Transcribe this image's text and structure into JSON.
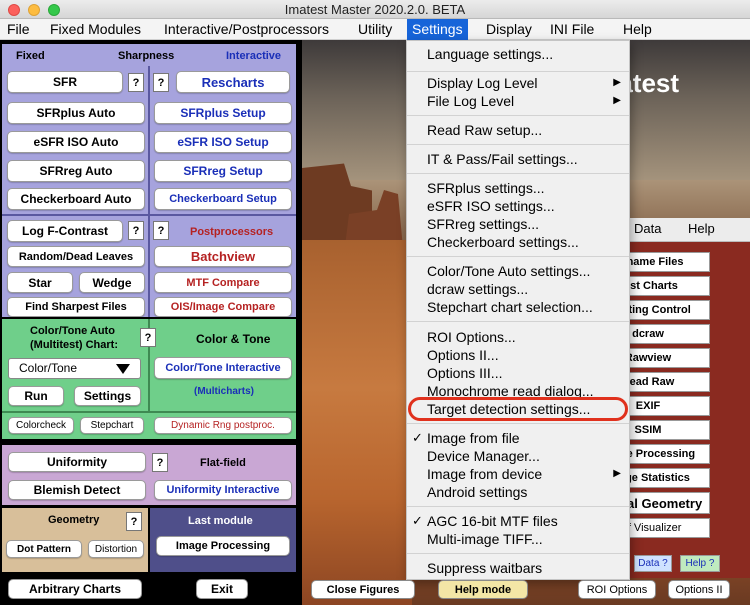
{
  "window": {
    "title": "Imatest Master 2020.2.0. BETA"
  },
  "menubar": {
    "items": [
      "File",
      "Fixed Modules",
      "Interactive/Postprocessors",
      "Utility",
      "Settings",
      "Display",
      "INI File",
      "Help"
    ]
  },
  "left": {
    "fixed_label": "Fixed",
    "sharpness_label": "Sharpness",
    "interactive_label": "Interactive",
    "sfr": "SFR",
    "rescharts": "Rescharts",
    "sfrplus_auto": "SFRplus Auto",
    "sfrplus_setup": "SFRplus Setup",
    "esfr_auto": "eSFR ISO Auto",
    "esfr_setup": "eSFR ISO Setup",
    "sfrreg_auto": "SFRreg Auto",
    "sfrreg_setup": "SFRreg Setup",
    "checker_auto": "Checkerboard Auto",
    "checker_setup": "Checkerboard Setup",
    "q": "?",
    "log_f": "Log F-Contrast",
    "postprocessors": "Postprocessors",
    "random_dead": "Random/Dead Leaves",
    "batchview": "Batchview",
    "star": "Star",
    "wedge": "Wedge",
    "mtf_compare": "MTF Compare",
    "find_sharpest": "Find Sharpest Files",
    "ois_compare": "OIS/Image Compare",
    "ct_auto": "Color/Tone Auto",
    "multitest_chart": "(Multitest)   Chart:",
    "color_tone_label": "Color & Tone",
    "ct_select": "Color/Tone",
    "ct_interactive": "Color/Tone Interactive",
    "multicharts": "(Multicharts)",
    "run": "Run",
    "settings": "Settings",
    "colorcheck": "Colorcheck",
    "stepchart": "Stepchart",
    "dynamic_rng": "Dynamic Rng postproc.",
    "uniformity": "Uniformity",
    "flat_field": "Flat-field",
    "blemish": "Blemish Detect",
    "uniformity_interactive": "Uniformity Interactive",
    "geometry": "Geometry",
    "last_module": "Last module",
    "dot_pattern": "Dot Pattern",
    "distortion": "Distortion",
    "image_processing": "Image Processing",
    "arbitrary_charts": "Arbitrary Charts",
    "exit": "Exit"
  },
  "bottom": {
    "close_figures": "Close Figures",
    "help_mode": "Help mode",
    "roi_options": "ROI Options",
    "options_ii": "Options II"
  },
  "inner": {
    "logo": "Imatest",
    "tabs": [
      "Data",
      "Help"
    ],
    "buttons": [
      "Rename Files",
      "Test Charts",
      "Lighting Control",
      "dcraw",
      "Rawview",
      "Read Raw",
      "EXIF",
      "SSIM",
      "Image Processing",
      "Image Statistics",
      "Optical Geometry",
      "Diff Visualizer"
    ],
    "data_q": "Data ?",
    "help_q": "Help ?"
  },
  "dropdown": {
    "items": [
      "Language settings...",
      "Display Log Level",
      "File Log Level",
      "Read Raw setup...",
      "IT & Pass/Fail settings...",
      "SFRplus settings...",
      "eSFR ISO settings...",
      "SFRreg settings...",
      "Checkerboard settings...",
      "Color/Tone Auto settings...",
      "dcraw settings...",
      "Stepchart chart selection...",
      "ROI Options...",
      "Options II...",
      "Options III...",
      "Monochrome read dialog...",
      "Target detection settings...",
      "Image from file",
      "Device Manager...",
      "Image from device",
      "Android settings",
      "AGC 16-bit MTF files",
      "Multi-image TIFF...",
      "Suppress waitbars"
    ],
    "submenu_arrow": "▶",
    "checkmark": "✓"
  },
  "colors": {
    "menu_highlight": "#1664d9",
    "sharpness_bg": "#a6a3dd",
    "color_tone_bg": "#6fcf8a",
    "uniformity_bg": "#c9a7d4",
    "geometry_bg": "#d8bf9a",
    "last_module_bg": "#4f4f8a",
    "target_highlight_ring": "#e0311d"
  }
}
